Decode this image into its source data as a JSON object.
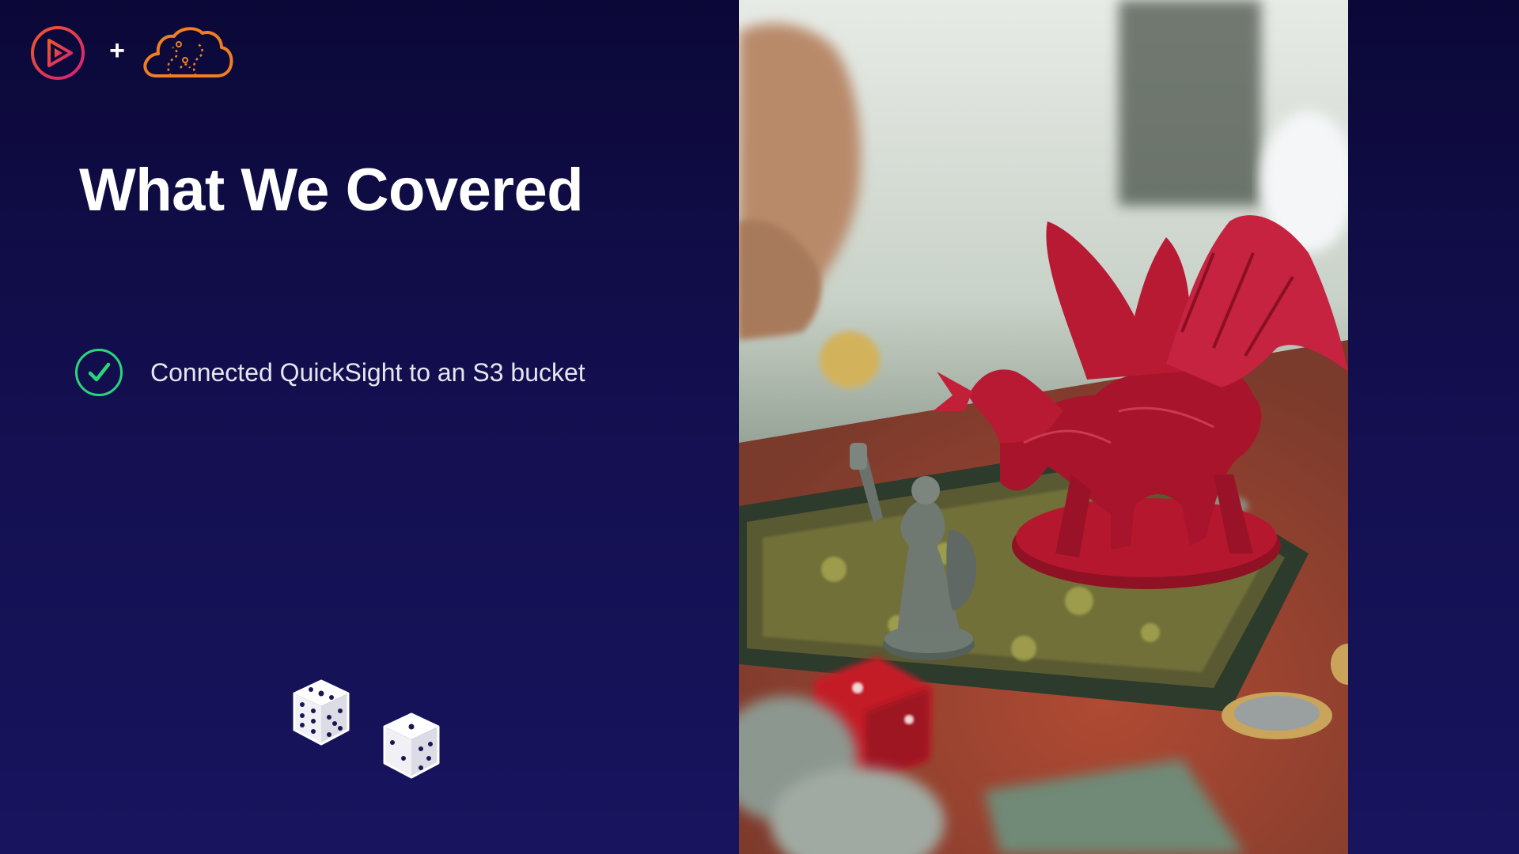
{
  "slide": {
    "title": "What We Covered",
    "bullets": [
      {
        "text": "Connected QuickSight to an S3 bucket",
        "icon": "check-circle-icon",
        "checked": true
      }
    ]
  },
  "logos": {
    "left": "pluralsight-play-logo",
    "separator": "+",
    "right": "cloud-logo"
  },
  "decorations": {
    "dice": [
      "dice-icon",
      "dice-icon"
    ]
  },
  "photo": {
    "subject": "photo-dragon-miniature"
  },
  "colors": {
    "background_top": "#0b0838",
    "background_bottom": "#18145e",
    "brand_pink": "#e0306a",
    "cloud_orange": "#ef7f22",
    "check_green": "#2bd67b",
    "dragon_red": "#b5172f"
  }
}
